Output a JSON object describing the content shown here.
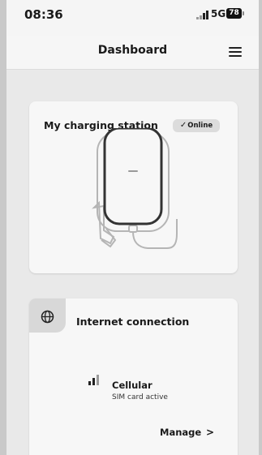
{
  "status_bar": {
    "time": "08:36",
    "network": "5G",
    "battery": "78"
  },
  "header": {
    "title": "Dashboard",
    "menu_icon": "hamburger-menu-icon"
  },
  "station": {
    "title": "My charging station",
    "status": "Online",
    "status_icon": "check-icon",
    "image_icon": "wallbox-charger-icon"
  },
  "internet": {
    "title": "Internet connection",
    "section_icon": "globe-icon",
    "connection_type": "Cellular",
    "connection_status": "SIM card active",
    "signal_icon": "cellular-signal-icon",
    "manage_label": "Manage",
    "manage_icon": "chevron-right-icon"
  }
}
